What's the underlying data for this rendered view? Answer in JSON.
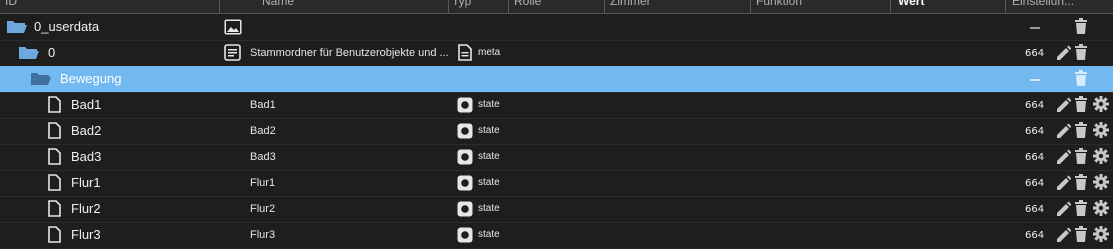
{
  "header": {
    "columns": [
      {
        "label": "ID"
      },
      {
        "label": "Name"
      },
      {
        "label": "Typ"
      },
      {
        "label": "Rolle"
      },
      {
        "label": "Zimmer"
      },
      {
        "label": "Funktion"
      },
      {
        "label": "Wert"
      },
      {
        "label": "Einstellun..."
      }
    ]
  },
  "rows": [
    {
      "id": "0_userdata",
      "name": "",
      "type": "",
      "rights": "",
      "icon": "folder-open-icon",
      "level": 0
    },
    {
      "id": "0",
      "name": "Stammordner für Benutzerobjekte und ...",
      "type": "meta",
      "rights": "664",
      "icon": "folder-open-icon",
      "level": 1
    },
    {
      "id": "Bewegung",
      "name": "",
      "type": "",
      "rights": "",
      "icon": "folder-open-icon",
      "level": 2,
      "selected": true
    },
    {
      "id": "Bad1",
      "name": "Bad1",
      "type": "state",
      "rights": "664",
      "icon": "file-icon",
      "level": 3
    },
    {
      "id": "Bad2",
      "name": "Bad2",
      "type": "state",
      "rights": "664",
      "icon": "file-icon",
      "level": 3
    },
    {
      "id": "Bad3",
      "name": "Bad3",
      "type": "state",
      "rights": "664",
      "icon": "file-icon",
      "level": 3
    },
    {
      "id": "Flur1",
      "name": "Flur1",
      "type": "state",
      "rights": "664",
      "icon": "file-icon",
      "level": 3
    },
    {
      "id": "Flur2",
      "name": "Flur2",
      "type": "state",
      "rights": "664",
      "icon": "file-icon",
      "level": 3
    },
    {
      "id": "Flur3",
      "name": "Flur3",
      "type": "state",
      "rights": "664",
      "icon": "file-icon",
      "level": 3
    }
  ],
  "colors": {
    "background": "#1e1e1e",
    "selected_row": "#72b9f2",
    "folder": "#6fa8dc"
  }
}
